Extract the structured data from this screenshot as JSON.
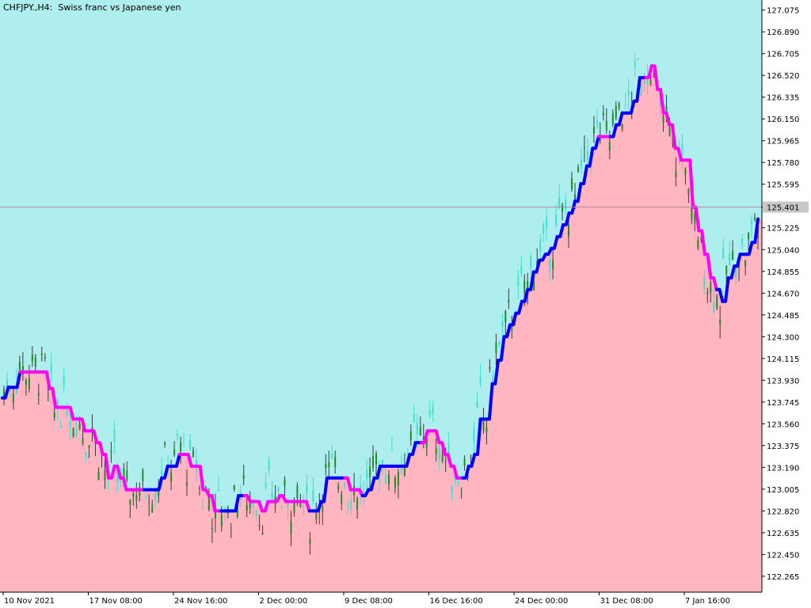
{
  "window": {
    "title": "CHFJPY.,H4:  Swiss franc vs Japanese yen"
  },
  "colors": {
    "upper_fill": "#afeeee",
    "lower_fill": "#ffb6c1",
    "line_up": "#0000ff",
    "line_down": "#ff00ff",
    "candle_bull": "#40e0d0",
    "candle_bear": "#228b22",
    "wick_dark": "#3a3a3a",
    "current_price_line": "#b08a9a"
  },
  "chart_data": {
    "type": "line",
    "title": "CHFJPY.,H4:  Swiss franc vs Japanese yen",
    "ylim": [
      122.13,
      127.16
    ],
    "y_ticks": [
      "127.075",
      "126.890",
      "126.705",
      "126.520",
      "126.335",
      "126.150",
      "125.965",
      "125.780",
      "125.595",
      "125.401",
      "125.225",
      "125.040",
      "124.855",
      "124.670",
      "124.485",
      "124.300",
      "124.115",
      "123.930",
      "123.745",
      "123.560",
      "123.375",
      "123.190",
      "123.005",
      "122.820",
      "122.635",
      "122.450",
      "122.265"
    ],
    "x_ticks": [
      "10 Nov 2021",
      "17 Nov 08:00",
      "24 Nov 16:00",
      "2 Dec 00:00",
      "9 Dec 08:00",
      "16 Dec 16:00",
      "24 Dec 00:00",
      "31 Dec 08:00",
      "7 Jan 16:00"
    ],
    "current_price": 125.401,
    "series": [
      {
        "points": [
          [
            0,
            123.78
          ],
          [
            1,
            123.87
          ],
          [
            2,
            123.87
          ],
          [
            3,
            124.0
          ],
          [
            4,
            124.0
          ],
          [
            5,
            124.0
          ],
          [
            6,
            124.0
          ],
          [
            7,
            124.0
          ],
          [
            8,
            123.86
          ],
          [
            9,
            123.7
          ],
          [
            10,
            123.7
          ],
          [
            11,
            123.7
          ],
          [
            12,
            123.6
          ],
          [
            13,
            123.6
          ],
          [
            14,
            123.5
          ],
          [
            15,
            123.5
          ],
          [
            16,
            123.4
          ],
          [
            17,
            123.3
          ],
          [
            18,
            123.1
          ],
          [
            19,
            123.2
          ],
          [
            20,
            123.1
          ],
          [
            21,
            123.0
          ],
          [
            22,
            123.0
          ],
          [
            23,
            123.0
          ],
          [
            24,
            123.0
          ],
          [
            25,
            123.0
          ],
          [
            26,
            123.0
          ],
          [
            27,
            123.1
          ],
          [
            28,
            123.2
          ],
          [
            29,
            123.2
          ],
          [
            30,
            123.3
          ],
          [
            31,
            123.3
          ],
          [
            32,
            123.2
          ],
          [
            33,
            123.2
          ],
          [
            34,
            123.0
          ],
          [
            35,
            122.95
          ],
          [
            36,
            122.82
          ],
          [
            37,
            122.82
          ],
          [
            38,
            122.82
          ],
          [
            39,
            122.82
          ],
          [
            40,
            122.95
          ],
          [
            41,
            122.95
          ],
          [
            42,
            122.9
          ],
          [
            43,
            122.9
          ],
          [
            44,
            122.82
          ],
          [
            45,
            122.9
          ],
          [
            46,
            122.9
          ],
          [
            47,
            122.95
          ],
          [
            48,
            122.9
          ],
          [
            49,
            122.9
          ],
          [
            50,
            122.9
          ],
          [
            51,
            122.9
          ],
          [
            52,
            122.82
          ],
          [
            53,
            122.82
          ],
          [
            54,
            122.9
          ],
          [
            55,
            123.1
          ],
          [
            56,
            123.1
          ],
          [
            57,
            123.1
          ],
          [
            58,
            123.1
          ],
          [
            59,
            123.0
          ],
          [
            60,
            123.0
          ],
          [
            61,
            122.95
          ],
          [
            62,
            123.0
          ],
          [
            63,
            123.1
          ],
          [
            64,
            123.2
          ],
          [
            65,
            123.2
          ],
          [
            66,
            123.2
          ],
          [
            67,
            123.2
          ],
          [
            68,
            123.2
          ],
          [
            69,
            123.3
          ],
          [
            70,
            123.4
          ],
          [
            71,
            123.4
          ],
          [
            72,
            123.5
          ],
          [
            73,
            123.5
          ],
          [
            74,
            123.4
          ],
          [
            75,
            123.3
          ],
          [
            76,
            123.2
          ],
          [
            77,
            123.1
          ],
          [
            78,
            123.1
          ],
          [
            79,
            123.2
          ],
          [
            80,
            123.3
          ],
          [
            81,
            123.6
          ],
          [
            82,
            123.6
          ],
          [
            83,
            123.9
          ],
          [
            84,
            124.1
          ],
          [
            85,
            124.3
          ],
          [
            86,
            124.4
          ],
          [
            87,
            124.5
          ],
          [
            88,
            124.6
          ],
          [
            89,
            124.7
          ],
          [
            90,
            124.85
          ],
          [
            91,
            124.95
          ],
          [
            92,
            125.0
          ],
          [
            93,
            125.05
          ],
          [
            94,
            125.15
          ],
          [
            95,
            125.25
          ],
          [
            96,
            125.35
          ],
          [
            97,
            125.45
          ],
          [
            98,
            125.6
          ],
          [
            99,
            125.75
          ],
          [
            100,
            125.9
          ],
          [
            101,
            126.0
          ],
          [
            102,
            126.0
          ],
          [
            103,
            126.0
          ],
          [
            104,
            126.1
          ],
          [
            105,
            126.2
          ],
          [
            106,
            126.2
          ],
          [
            107,
            126.3
          ],
          [
            108,
            126.5
          ],
          [
            109,
            126.5
          ],
          [
            110,
            126.6
          ],
          [
            111,
            126.4
          ],
          [
            112,
            126.2
          ],
          [
            113,
            126.1
          ],
          [
            114,
            125.9
          ],
          [
            115,
            125.8
          ],
          [
            116,
            125.8
          ],
          [
            117,
            125.4
          ],
          [
            118,
            125.2
          ],
          [
            119,
            125.0
          ],
          [
            120,
            124.8
          ],
          [
            121,
            124.7
          ],
          [
            122,
            124.6
          ],
          [
            123,
            124.8
          ],
          [
            124,
            124.9
          ],
          [
            125,
            125.0
          ],
          [
            126,
            125.0
          ],
          [
            127,
            125.1
          ],
          [
            128,
            125.3
          ]
        ],
        "direction": [
          "up",
          "up",
          "up",
          "up",
          "down",
          "down",
          "down",
          "down",
          "down",
          "down",
          "down",
          "down",
          "down",
          "down",
          "down",
          "down",
          "down",
          "down",
          "down",
          "down",
          "down",
          "down",
          "down",
          "down",
          "down",
          "up",
          "up",
          "up",
          "up",
          "up",
          "up",
          "down",
          "down",
          "down",
          "down",
          "down",
          "down",
          "down",
          "up",
          "up",
          "up",
          "up",
          "down",
          "down",
          "down",
          "down",
          "down",
          "down",
          "down",
          "down",
          "down",
          "down",
          "down",
          "up",
          "up",
          "up",
          "up",
          "up",
          "up",
          "down",
          "down",
          "down",
          "up",
          "up",
          "up",
          "up",
          "up",
          "up",
          "up",
          "up",
          "up",
          "up",
          "down",
          "down",
          "down",
          "down",
          "down",
          "down",
          "down",
          "up",
          "up",
          "up",
          "up",
          "up",
          "up",
          "up",
          "up",
          "up",
          "up",
          "up",
          "up",
          "up",
          "up",
          "up",
          "up",
          "up",
          "up",
          "up",
          "up",
          "up",
          "up",
          "up",
          "down",
          "down",
          "up",
          "up",
          "up",
          "up",
          "up",
          "up",
          "down",
          "down",
          "down",
          "down",
          "down",
          "down",
          "down",
          "down",
          "down",
          "down",
          "down",
          "down",
          "up",
          "up",
          "up",
          "up",
          "up",
          "up",
          "up"
        ]
      }
    ]
  }
}
